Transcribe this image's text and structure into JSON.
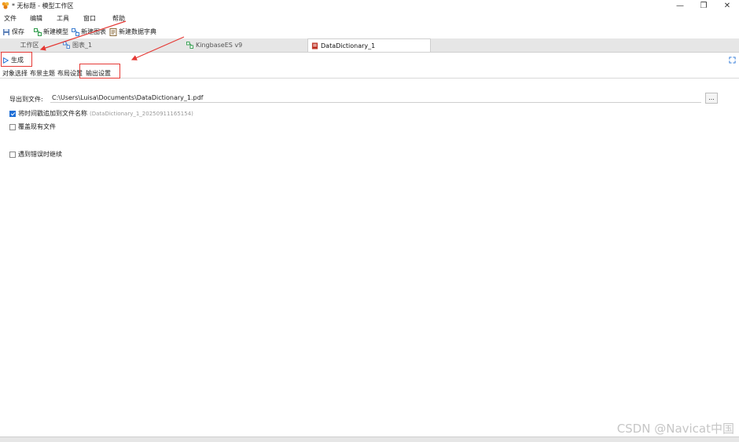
{
  "window": {
    "title": "* 无标题 - 模型工作区",
    "controls": {
      "minimize": "—",
      "restore": "❐",
      "close": "✕"
    }
  },
  "menu": {
    "items": [
      "文件",
      "编辑",
      "工具",
      "窗口",
      "帮助"
    ]
  },
  "toolbar": {
    "save": "保存",
    "new_model": "新建模型",
    "new_chart": "新建图表",
    "new_data_dictionary": "新建数据字典"
  },
  "tabs": [
    {
      "label": "工作区",
      "active": false
    },
    {
      "label": "图表_1",
      "active": false
    },
    {
      "label": "KingbaseES v9",
      "active": false
    },
    {
      "label": "DataDictionary_1",
      "active": true
    }
  ],
  "action": {
    "generate": "生成"
  },
  "subtabs": [
    "对象选择",
    "布景主题",
    "布局设置",
    "输出设置"
  ],
  "form": {
    "export_label": "导出到文件:",
    "path_value": "C:\\Users\\Luisa\\Documents\\DataDictionary_1.pdf",
    "browse": "...",
    "append_timestamp": {
      "label": "将时间戳追加到文件名称",
      "hint": "(DataDictionary_1_20250911165154)",
      "checked": true
    },
    "overwrite": {
      "label": "覆盖现有文件",
      "checked": false
    },
    "continue_on_error": {
      "label": "遇到错误时继续",
      "checked": false
    }
  },
  "watermark": "CSDN @Navicat中国",
  "colors": {
    "accent": "#1f6fd6",
    "annotation": "#e53935",
    "tab_bg": "#e6e6e6"
  }
}
